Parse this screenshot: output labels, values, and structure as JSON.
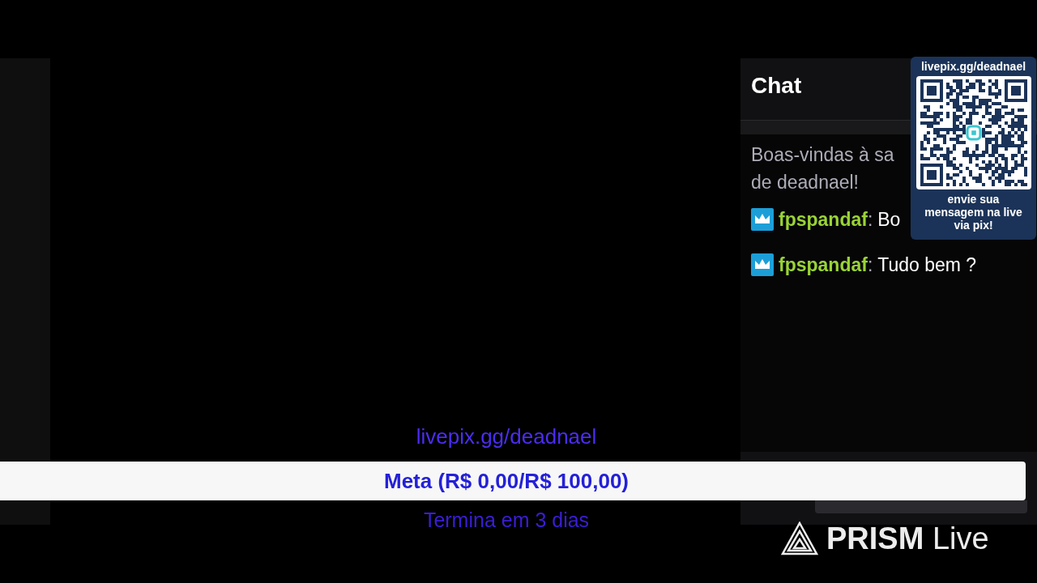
{
  "chat": {
    "title": "Chat",
    "welcome_lines": [
      "Boas-vindas à sa",
      "de deadnael!"
    ],
    "messages": [
      {
        "user": "fpspandaf",
        "separator": ":",
        "text": "Bo",
        "badge": true
      },
      {
        "user": "fpspandaf",
        "separator": ":",
        "text": "Tudo bem ?",
        "badge": true
      }
    ]
  },
  "qr_overlay": {
    "url": "livepix.gg/deadnael",
    "caption_lines": [
      "envie sua",
      "mensagem na live",
      "via pix!"
    ]
  },
  "goal": {
    "link": "livepix.gg/deadnael",
    "label": "Meta (R$ 0,00/R$ 100,00)",
    "ends": "Termina em 3 dias"
  },
  "watermark_logo": {
    "brand": "PRISM",
    "suffix": "Live"
  }
}
